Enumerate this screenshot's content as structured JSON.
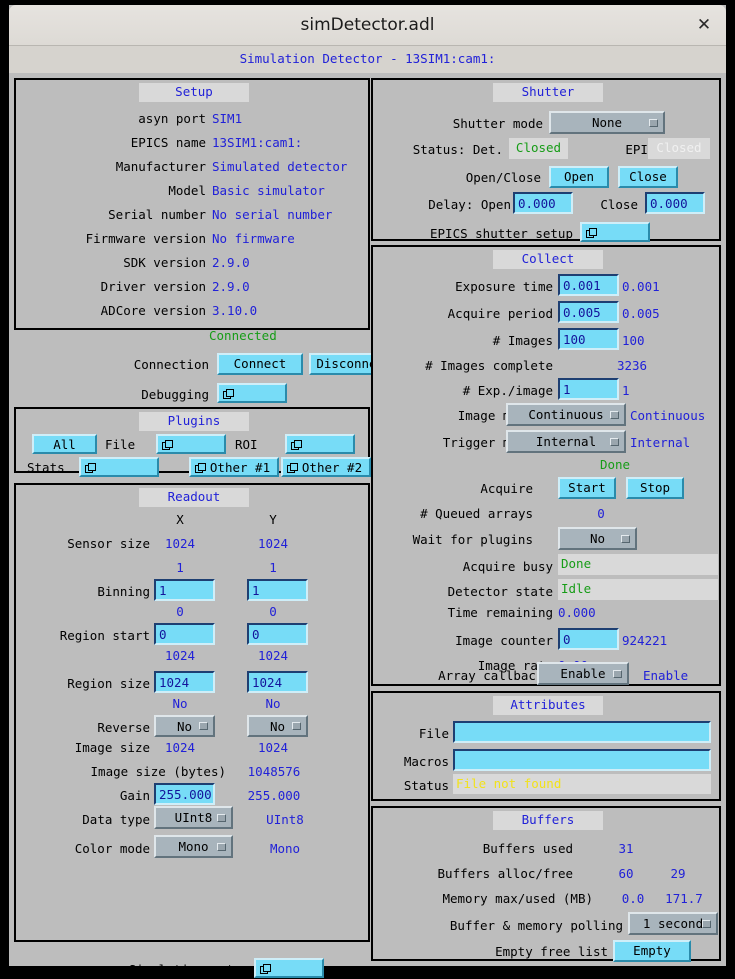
{
  "window": {
    "title": "simDetector.adl",
    "close_icon": "close-icon",
    "subtitle": "Simulation Detector - 13SIM1:cam1:"
  },
  "colors": {
    "panel_bg": "#bdbdbd",
    "value_blue": "#2121d8",
    "ok_green": "#179c17",
    "warn_yellow": "#f2e21a",
    "field_cyan": "#77dcf7",
    "menu_grey": "#a8b4bc"
  },
  "setup": {
    "title": "Setup",
    "rows": [
      {
        "label": "asyn port",
        "value": "SIM1"
      },
      {
        "label": "EPICS name",
        "value": "13SIM1:cam1:"
      },
      {
        "label": "Manufacturer",
        "value": "Simulated detector"
      },
      {
        "label": "Model",
        "value": "Basic simulator"
      },
      {
        "label": "Serial number",
        "value": "No serial number"
      },
      {
        "label": "Firmware version",
        "value": "No firmware"
      },
      {
        "label": "SDK version",
        "value": "2.9.0"
      },
      {
        "label": "Driver version",
        "value": "2.9.0"
      },
      {
        "label": "ADCore version",
        "value": "3.10.0"
      }
    ],
    "connection_status": "Connected",
    "connection_label": "Connection",
    "connect_label": "Connect",
    "disconnect_label": "Disconnect",
    "debugging_label": "Debugging",
    "debugging_icon": "related-display-icon"
  },
  "plugins": {
    "title": "Plugins",
    "all_label": "All",
    "file_label": "File",
    "file_icon": "related-display-icon",
    "roi_label": "ROI",
    "roi_icon": "related-display-icon",
    "stats_label": "Stats",
    "stats_icon": "related-display-icon",
    "other1_label": "Other #1",
    "other2_label": "Other #2"
  },
  "readout": {
    "title": "Readout",
    "col_x": "X",
    "col_y": "Y",
    "sensor_size_label": "Sensor size",
    "sensor_size_x": "1024",
    "sensor_size_y": "1024",
    "binning_label": "Binning",
    "binning_x_readback": "1",
    "binning_y_readback": "1",
    "binning_x_value": "1",
    "binning_y_value": "1",
    "region_start_label": "Region start",
    "region_start_x_readback": "0",
    "region_start_y_readback": "0",
    "region_start_x_value": "0",
    "region_start_y_value": "0",
    "region_size_label": "Region size",
    "region_size_x_readback": "1024",
    "region_size_y_readback": "1024",
    "region_size_x_value": "1024",
    "region_size_y_value": "1024",
    "reverse_label": "Reverse",
    "reverse_x_readback": "No",
    "reverse_y_readback": "No",
    "reverse_x_value": "No",
    "reverse_y_value": "No",
    "image_size_label": "Image size",
    "image_size_x": "1024",
    "image_size_y": "1024",
    "image_bytes_label": "Image size (bytes)",
    "image_bytes_value": "1048576",
    "gain_label": "Gain",
    "gain_value": "255.000",
    "gain_readback": "255.000",
    "data_type_label": "Data type",
    "data_type_value": "UInt8",
    "data_type_readback": "UInt8",
    "color_mode_label": "Color mode",
    "color_mode_value": "Mono",
    "color_mode_readback": "Mono"
  },
  "simulation": {
    "label": "Simulation setup",
    "icon": "related-display-icon"
  },
  "shutter": {
    "title": "Shutter",
    "mode_label": "Shutter mode",
    "mode_value": "None",
    "status_label": "Status: Det.",
    "status_det_value": "Closed",
    "epics_label": "EPICS",
    "status_epics_value": "Closed",
    "openclose_label": "Open/Close",
    "open_label": "Open",
    "close_label": "Close",
    "delay_label": "Delay: Open",
    "delay_open_value": "0.000",
    "delay_close_label": "Close",
    "delay_close_value": "0.000",
    "epics_setup_label": "EPICS shutter setup",
    "epics_setup_icon": "related-display-icon"
  },
  "collect": {
    "title": "Collect",
    "exposure_label": "Exposure time",
    "exposure_value": "0.001",
    "exposure_readback": "0.001",
    "period_label": "Acquire period",
    "period_value": "0.005",
    "period_readback": "0.005",
    "nimages_label": "# Images",
    "nimages_value": "100",
    "nimages_readback": "100",
    "complete_label": "# Images complete",
    "complete_value": "3236",
    "expperimage_label": "# Exp./image",
    "expperimage_value": "1",
    "expperimage_readback": "1",
    "image_mode_label": "Image mode",
    "image_mode_value": "Continuous",
    "image_mode_readback": "Continuous",
    "trigger_mode_label": "Trigger mode",
    "trigger_mode_value": "Internal",
    "trigger_mode_readback": "Internal",
    "detector_status": "Done",
    "acquire_label": "Acquire",
    "start_label": "Start",
    "stop_label": "Stop",
    "queued_label": "# Queued arrays",
    "queued_value": "0",
    "wait_plugins_label": "Wait for plugins",
    "wait_plugins_value": "No",
    "acquire_busy_label": "Acquire busy",
    "acquire_busy_value": "Done",
    "detector_state_label": "Detector state",
    "detector_state_value": "Idle",
    "time_remaining_label": "Time remaining",
    "time_remaining_value": "0.000",
    "image_counter_label": "Image counter",
    "image_counter_value": "0",
    "image_counter_readback": "924221",
    "image_rate_label": "Image rate",
    "image_rate_value": "0.00",
    "array_callbacks_label": "Array callbacks",
    "array_callbacks_value": "Enable",
    "array_callbacks_readback": "Enable"
  },
  "attributes": {
    "title": "Attributes",
    "file_label": "File",
    "file_value": "",
    "macros_label": "Macros",
    "macros_value": "",
    "status_label": "Status",
    "status_value": "File not found"
  },
  "buffers": {
    "title": "Buffers",
    "used_label": "Buffers used",
    "used_value": "31",
    "allocfree_label": "Buffers alloc/free",
    "alloc_value": "60",
    "free_value": "29",
    "memory_label": "Memory max/used (MB)",
    "memory_max_value": "0.0",
    "memory_used_value": "171.7",
    "polling_label": "Buffer & memory polling",
    "polling_value": "1 second",
    "emptylist_label": "Empty free list",
    "empty_btn_label": "Empty"
  }
}
